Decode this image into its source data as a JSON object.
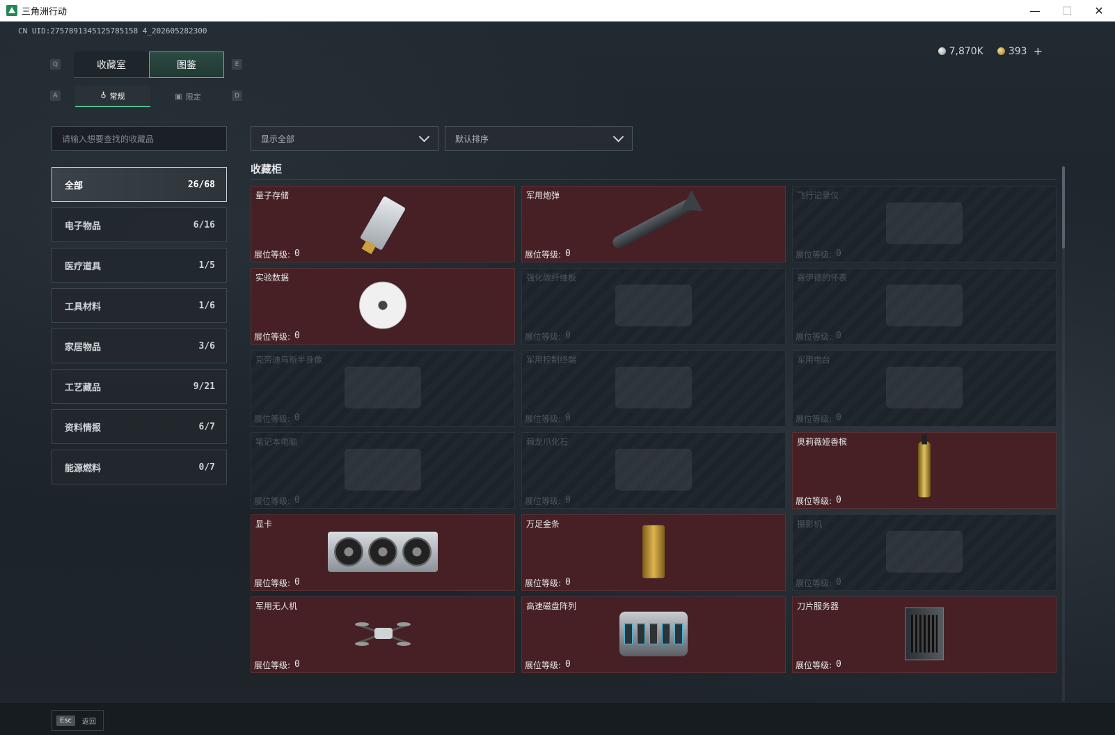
{
  "window": {
    "title": "三角洲行动",
    "controls": {
      "minimize": "—",
      "maximize": "☐",
      "close": "✕"
    }
  },
  "header": {
    "uid": "CN UID:2757891345125785158 4_202605282300",
    "silver": "7,870K",
    "gold": "393",
    "plus": "+"
  },
  "keys": {
    "q": "Q",
    "e": "E",
    "a": "A",
    "d": "D"
  },
  "tabs": [
    {
      "label": "收藏室",
      "active": false
    },
    {
      "label": "图鉴",
      "active": true
    }
  ],
  "subtabs": [
    {
      "label": "常规",
      "icon": "♁",
      "active": true
    },
    {
      "label": "限定",
      "icon": "▣",
      "active": false
    }
  ],
  "search": {
    "placeholder": "请输入想要查找的收藏品"
  },
  "filters": {
    "show": "显示全部",
    "sort": "默认排序"
  },
  "categories": [
    {
      "label": "全部",
      "count": "26/68",
      "active": true
    },
    {
      "label": "电子物品",
      "count": "6/16"
    },
    {
      "label": "医疗道具",
      "count": "1/5"
    },
    {
      "label": "工具材料",
      "count": "1/6"
    },
    {
      "label": "家居物品",
      "count": "3/6"
    },
    {
      "label": "工艺藏品",
      "count": "9/21"
    },
    {
      "label": "资料情报",
      "count": "6/7"
    },
    {
      "label": "能源燃料",
      "count": "0/7"
    }
  ],
  "section": {
    "title": "收藏柜"
  },
  "level_label": "展位等级:",
  "items": [
    {
      "name": "量子存储",
      "level": "0",
      "owned": true,
      "art": "usb"
    },
    {
      "name": "军用炮弹",
      "level": "0",
      "owned": true,
      "art": "missile"
    },
    {
      "name": "飞行记录仪",
      "level": "0",
      "owned": false,
      "art": "ghost"
    },
    {
      "name": "实验数据",
      "level": "0",
      "owned": true,
      "art": "disc"
    },
    {
      "name": "强化碳纤维板",
      "level": "0",
      "owned": false,
      "art": "ghost"
    },
    {
      "name": "赛伊德的怀表",
      "level": "0",
      "owned": false,
      "art": "ghost"
    },
    {
      "name": "克劳迪乌斯半身像",
      "level": "0",
      "owned": false,
      "art": "ghost"
    },
    {
      "name": "军用控制终端",
      "level": "0",
      "owned": false,
      "art": "ghost"
    },
    {
      "name": "军用电台",
      "level": "0",
      "owned": false,
      "art": "ghost"
    },
    {
      "name": "笔记本电脑",
      "level": "0",
      "owned": false,
      "art": "ghost"
    },
    {
      "name": "棘龙爪化石",
      "level": "0",
      "owned": false,
      "art": "ghost"
    },
    {
      "name": "奥莉薇娅香槟",
      "level": "0",
      "owned": true,
      "art": "bottle"
    },
    {
      "name": "显卡",
      "level": "0",
      "owned": true,
      "art": "gpu"
    },
    {
      "name": "万足金条",
      "level": "0",
      "owned": true,
      "art": "goldbar"
    },
    {
      "name": "摄影机",
      "level": "0",
      "owned": false,
      "art": "ghost"
    },
    {
      "name": "军用无人机",
      "level": "0",
      "owned": true,
      "art": "drone"
    },
    {
      "name": "高速磁盘阵列",
      "level": "0",
      "owned": true,
      "art": "raid"
    },
    {
      "name": "刀片服务器",
      "level": "0",
      "owned": true,
      "art": "server"
    }
  ],
  "footer": {
    "esc_key": "Esc",
    "back_label": "返回"
  }
}
